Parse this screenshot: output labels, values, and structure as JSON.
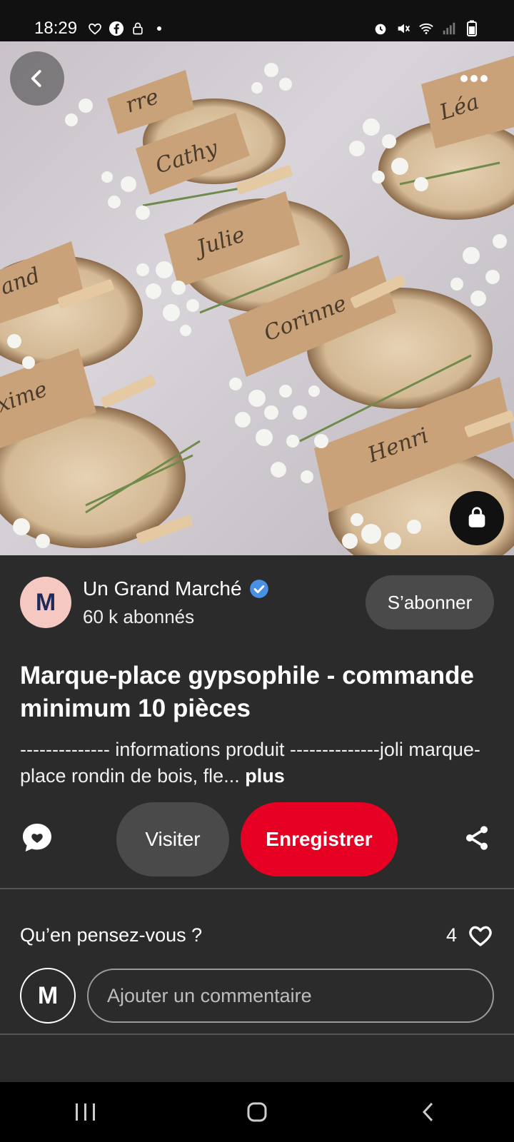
{
  "status_bar": {
    "time": "18:29",
    "left_icons": [
      "heart-outline-icon",
      "facebook-icon",
      "lock-icon",
      "dot-icon"
    ],
    "right_icons": [
      "alarm-icon",
      "mute-icon",
      "wifi-icon",
      "signal-icon",
      "battery-icon"
    ]
  },
  "hero": {
    "card_names": [
      "Cathy",
      "Julie",
      "Corinne",
      "Henri",
      "Léa",
      "xime",
      "and",
      "rre"
    ],
    "colors": {
      "card": "#c9a27a",
      "wood": "#d9c3a5",
      "flowers": "#f4f4f0",
      "stem": "#6f8a4a"
    }
  },
  "creator": {
    "avatar_letter": "M",
    "name": "Un Grand Marché",
    "subscribers": "60 k abonnés",
    "follow_label": "S’abonner"
  },
  "pin": {
    "title": "Marque-place gypsophile - commande minimum 10 pièces",
    "description": "-------------- informations produit --------------joli marque-place rondin de bois, fle...",
    "more_label": "plus"
  },
  "actions": {
    "visit_label": "Visiter",
    "save_label": "Enregistrer"
  },
  "comments": {
    "question": "Qu’en pensez-vous ?",
    "like_count": "4",
    "user_avatar_letter": "M",
    "placeholder": "Ajouter un commentaire"
  },
  "colors": {
    "accent_red": "#e60023",
    "background": "#2b2b2b",
    "button_gray": "#4a4a4a",
    "verified_blue": "#4a90e2"
  }
}
